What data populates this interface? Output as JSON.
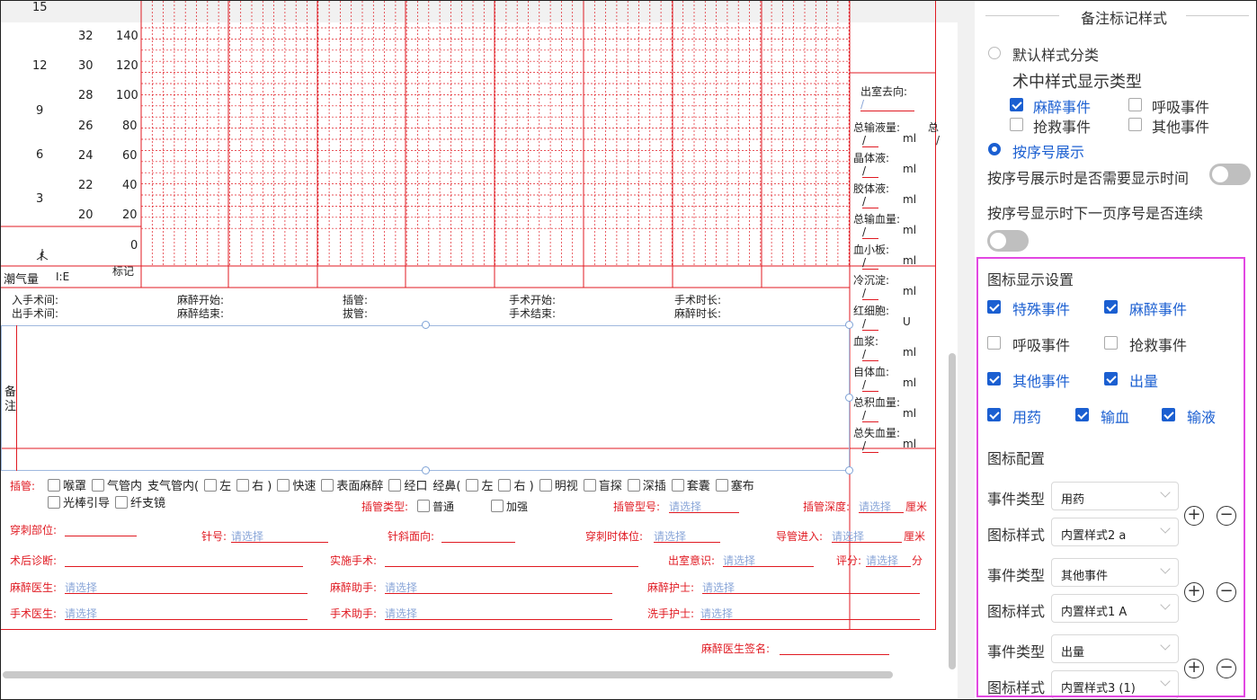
{
  "chart": {
    "col1": [
      "15",
      "12",
      "9",
      "6",
      "3"
    ],
    "col2": [
      "32",
      "30",
      "28",
      "26",
      "24",
      "22",
      "20"
    ],
    "col3": [
      "140",
      "120",
      "100",
      "80",
      "60",
      "40",
      "20",
      "0"
    ],
    "row_label_left": "潮气量",
    "f_label": "f",
    "ie_label": "I:E",
    "mark_label": "标记"
  },
  "fluids": {
    "exit_dir_label": "出室去向:",
    "exit_dir_value": "/",
    "items": [
      {
        "label": "总输液量:",
        "value": "/",
        "unit": "ml"
      },
      {
        "label": "晶体液:",
        "value": "/",
        "unit": "ml"
      },
      {
        "label": "胶体液:",
        "value": "/",
        "unit": "ml"
      },
      {
        "label": "总输血量:",
        "value": "/",
        "unit": "ml"
      },
      {
        "label": "血小板:",
        "value": "/",
        "unit": "ml"
      },
      {
        "label": "冷沉淀:",
        "value": "/",
        "unit": "ml"
      },
      {
        "label": "红细胞:",
        "value": "/",
        "unit": "U"
      },
      {
        "label": "血浆:",
        "value": "/",
        "unit": "ml"
      },
      {
        "label": "自体血:",
        "value": "/",
        "unit": "ml"
      },
      {
        "label": "总积血量:",
        "value": "/",
        "unit": "ml"
      },
      {
        "label": "总失血量:",
        "value": "/",
        "unit": "ml"
      }
    ],
    "total_cut": "总",
    "total_cut_value": "/"
  },
  "times": {
    "in_room": "入手术间:",
    "out_room": "出手术间:",
    "anes_start": "麻醉开始:",
    "anes_end": "麻醉结束:",
    "intub": "插管:",
    "extub": "拔管:",
    "op_start": "手术开始:",
    "op_end": "手术结束:",
    "op_duration": "手术时长:",
    "anes_duration": "麻醉时长:"
  },
  "remarks_label": [
    "备",
    "注"
  ],
  "intubation": {
    "label": "插管:",
    "options_row1": [
      "喉罩",
      "气管内",
      "支气管内(",
      "左",
      "右 )",
      "快速",
      "表面麻醉",
      "经口",
      "经鼻(",
      "左",
      "右 )",
      "明视",
      "盲探",
      "深插",
      "套囊",
      "塞布"
    ],
    "options_row2": [
      "光棒引导",
      "纤支镜"
    ],
    "type_label": "插管类型:",
    "type_options": [
      "普通",
      "加强"
    ],
    "model_label": "插管型号:",
    "model_placeholder": "请选择",
    "depth_label": "插管深度:",
    "depth_placeholder": "请选择",
    "depth_unit": "厘米"
  },
  "form": {
    "puncture_site": "穿刺部位:",
    "needle": "针号:",
    "needle_ph": "请选择",
    "bevel": "针斜面向:",
    "position": "穿刺时体位:",
    "position_ph": "请选择",
    "catheter": "导管进入:",
    "catheter_ph": "请选择",
    "catheter_unit": "厘米",
    "postop_dx": "术后诊断:",
    "procedure": "实施手术:",
    "consciousness": "出室意识:",
    "consciousness_ph": "请选择",
    "score": "评分:",
    "score_ph": "请选择",
    "score_unit": "分",
    "anesthetist": "麻醉医生:",
    "anesthetist_ph": "请选择",
    "anes_assistant": "麻醉助手:",
    "anes_assistant_ph": "请选择",
    "anes_nurse": "麻醉护士:",
    "anes_nurse_ph": "请选择",
    "surgeon": "手术医生:",
    "surgeon_ph": "请选择",
    "surg_assistant": "手术助手:",
    "surg_assistant_ph": "请选择",
    "scrub_nurse": "洗手护士:",
    "scrub_nurse_ph": "请选择",
    "signature": "麻醉医生签名:"
  },
  "panel": {
    "title": "备注标记样式",
    "default_style": "默认样式分类",
    "intraop_type": "术中样式显示类型",
    "type_checks": [
      {
        "label": "麻醉事件",
        "checked": true
      },
      {
        "label": "呼吸事件",
        "checked": false
      },
      {
        "label": "抢救事件",
        "checked": false
      },
      {
        "label": "其他事件",
        "checked": false
      }
    ],
    "by_sequence": "按序号展示",
    "show_time_q": "按序号展示时是否需要显示时间",
    "continue_q": "按序号显示时下一页序号是否连续",
    "icon_display": "图标显示设置",
    "icon_checks": [
      {
        "label": "特殊事件",
        "checked": true
      },
      {
        "label": "麻醉事件",
        "checked": true
      },
      {
        "label": "呼吸事件",
        "checked": false
      },
      {
        "label": "抢救事件",
        "checked": false
      },
      {
        "label": "其他事件",
        "checked": true
      },
      {
        "label": "出量",
        "checked": true
      },
      {
        "label": "用药",
        "checked": true
      },
      {
        "label": "输血",
        "checked": true
      },
      {
        "label": "输液",
        "checked": true
      }
    ],
    "icon_config": "图标配置",
    "event_type_label": "事件类型",
    "icon_style_label": "图标样式",
    "configs": [
      {
        "event": "用药",
        "style": "内置样式2 a"
      },
      {
        "event": "其他事件",
        "style": "内置样式1 A"
      },
      {
        "event": "出量",
        "style": "内置样式3 (1)"
      }
    ],
    "plus": "+",
    "minus": "−"
  }
}
